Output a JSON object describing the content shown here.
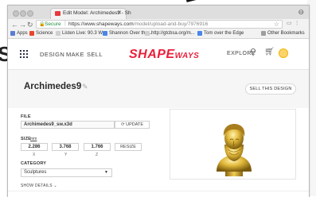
{
  "browser": {
    "tab_title": "Edit Model: Archimedes9 - Sh",
    "secure_label": "Secure",
    "url_host": "https://www.shapeways.com",
    "url_path": "/model/upload-and-buy/7976916",
    "bookmarks": [
      {
        "label": "Apps",
        "icon": "apps-grid-icon"
      },
      {
        "label": "Science",
        "icon": "science-bookmark-icon"
      },
      {
        "label": "Listen Live: 90.3 W...",
        "icon": "radio-bookmark-icon"
      },
      {
        "label": "Shannon Over the...",
        "icon": "page-bookmark-icon"
      },
      {
        "label": "http://gtcbsa.org/m...",
        "icon": "page-bookmark-icon"
      },
      {
        "label": "Tom over the Edge",
        "icon": "page-bookmark-icon"
      },
      {
        "label": "Other Bookmarks",
        "icon": "folder-icon"
      }
    ]
  },
  "site": {
    "nav": [
      "DESIGN",
      "MAKE",
      "SELL"
    ],
    "logo_main": "SHAPE",
    "logo_small": "WAYS",
    "explore": "EXPLORE"
  },
  "model": {
    "title": "Archimedes9",
    "sell_button": "SELL THIS DESIGN"
  },
  "form": {
    "file_label": "FILE",
    "file_name": "Archimedes9_sw.x3d",
    "update_button": "UPDATE",
    "size_label": "SIZE",
    "size_unit": "mm",
    "dimensions": [
      {
        "value": "2.286",
        "axis": "X"
      },
      {
        "value": "3.768",
        "axis": "Y"
      },
      {
        "value": "1.766",
        "axis": "Z"
      }
    ],
    "resize_button": "RESIZE",
    "category_label": "CATEGORY",
    "category_value": "Sculptures",
    "show_details": "SHOW DETAILS"
  },
  "colors": {
    "brand_red": "#ea1f3b",
    "gold": "#c9a227"
  }
}
